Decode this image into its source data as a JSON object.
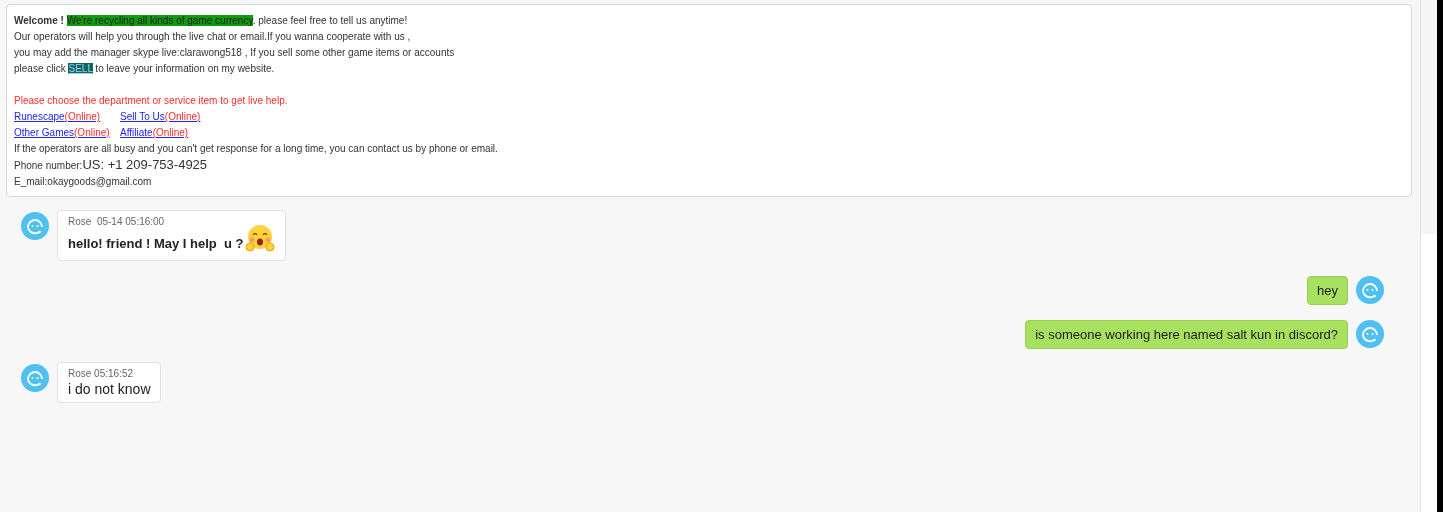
{
  "notice": {
    "welcome": {
      "bold": "Welcome !",
      "highlight": "We're recycling all kinds of game currency",
      "rest": ". please feel free to tell us anytime!"
    },
    "lines": [
      "Our operators will help you through the live chat or email.If you wanna cooperate with us ,",
      "you may add the manager skype live:clarawong518 , If you sell some other game items or accounts"
    ],
    "sell_line": {
      "before": "please click",
      "link": "SELL",
      "after": "to leave your information on my website."
    },
    "prompt": "Please choose the department or service item to get live help.",
    "departments": [
      {
        "name": "Runescape",
        "status": "(Online)"
      },
      {
        "name": "Sell To Us",
        "status": "(Online)"
      },
      {
        "name": "Other Games",
        "status": "(Online)"
      },
      {
        "name": "Affiliate",
        "status": "(Online)"
      }
    ],
    "busy_note": "If the operators are all busy and you can't get response for a long time, you can contact us by phone or email.",
    "phone": {
      "label": "Phone number:",
      "value": "US: +1 209-753-4925"
    },
    "email": "E_mail:okaygoods@gmail.com"
  },
  "messages": [
    {
      "kind": "agent",
      "sender": "Rose",
      "time": "05-14 05:16:00",
      "text": "hello! friend ! May I help  u ?",
      "bold": true,
      "emoji": true
    },
    {
      "kind": "user",
      "text": "hey"
    },
    {
      "kind": "user",
      "text": "is someone working here named salt kun in discord?"
    },
    {
      "kind": "agent",
      "sender": "Rose",
      "time": "05:16:52",
      "text": "i do not know",
      "bold": false,
      "emoji": false
    }
  ]
}
